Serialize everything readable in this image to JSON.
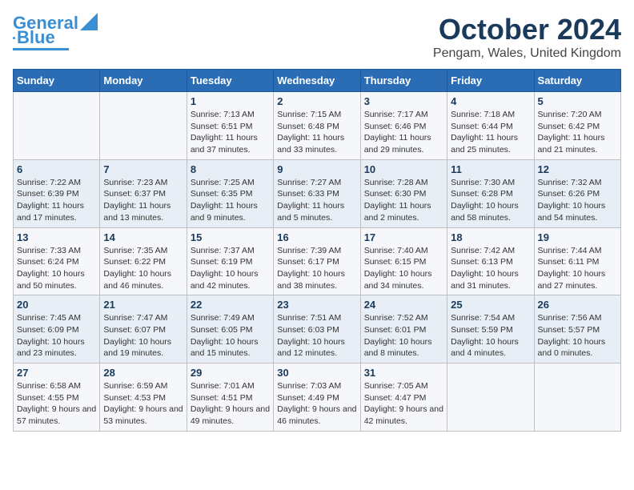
{
  "logo": {
    "line1": "General",
    "line2": "Blue"
  },
  "title": "October 2024",
  "subtitle": "Pengam, Wales, United Kingdom",
  "headers": [
    "Sunday",
    "Monday",
    "Tuesday",
    "Wednesday",
    "Thursday",
    "Friday",
    "Saturday"
  ],
  "rows": [
    [
      {
        "num": "",
        "info": ""
      },
      {
        "num": "",
        "info": ""
      },
      {
        "num": "1",
        "info": "Sunrise: 7:13 AM\nSunset: 6:51 PM\nDaylight: 11 hours and 37 minutes."
      },
      {
        "num": "2",
        "info": "Sunrise: 7:15 AM\nSunset: 6:48 PM\nDaylight: 11 hours and 33 minutes."
      },
      {
        "num": "3",
        "info": "Sunrise: 7:17 AM\nSunset: 6:46 PM\nDaylight: 11 hours and 29 minutes."
      },
      {
        "num": "4",
        "info": "Sunrise: 7:18 AM\nSunset: 6:44 PM\nDaylight: 11 hours and 25 minutes."
      },
      {
        "num": "5",
        "info": "Sunrise: 7:20 AM\nSunset: 6:42 PM\nDaylight: 11 hours and 21 minutes."
      }
    ],
    [
      {
        "num": "6",
        "info": "Sunrise: 7:22 AM\nSunset: 6:39 PM\nDaylight: 11 hours and 17 minutes."
      },
      {
        "num": "7",
        "info": "Sunrise: 7:23 AM\nSunset: 6:37 PM\nDaylight: 11 hours and 13 minutes."
      },
      {
        "num": "8",
        "info": "Sunrise: 7:25 AM\nSunset: 6:35 PM\nDaylight: 11 hours and 9 minutes."
      },
      {
        "num": "9",
        "info": "Sunrise: 7:27 AM\nSunset: 6:33 PM\nDaylight: 11 hours and 5 minutes."
      },
      {
        "num": "10",
        "info": "Sunrise: 7:28 AM\nSunset: 6:30 PM\nDaylight: 11 hours and 2 minutes."
      },
      {
        "num": "11",
        "info": "Sunrise: 7:30 AM\nSunset: 6:28 PM\nDaylight: 10 hours and 58 minutes."
      },
      {
        "num": "12",
        "info": "Sunrise: 7:32 AM\nSunset: 6:26 PM\nDaylight: 10 hours and 54 minutes."
      }
    ],
    [
      {
        "num": "13",
        "info": "Sunrise: 7:33 AM\nSunset: 6:24 PM\nDaylight: 10 hours and 50 minutes."
      },
      {
        "num": "14",
        "info": "Sunrise: 7:35 AM\nSunset: 6:22 PM\nDaylight: 10 hours and 46 minutes."
      },
      {
        "num": "15",
        "info": "Sunrise: 7:37 AM\nSunset: 6:19 PM\nDaylight: 10 hours and 42 minutes."
      },
      {
        "num": "16",
        "info": "Sunrise: 7:39 AM\nSunset: 6:17 PM\nDaylight: 10 hours and 38 minutes."
      },
      {
        "num": "17",
        "info": "Sunrise: 7:40 AM\nSunset: 6:15 PM\nDaylight: 10 hours and 34 minutes."
      },
      {
        "num": "18",
        "info": "Sunrise: 7:42 AM\nSunset: 6:13 PM\nDaylight: 10 hours and 31 minutes."
      },
      {
        "num": "19",
        "info": "Sunrise: 7:44 AM\nSunset: 6:11 PM\nDaylight: 10 hours and 27 minutes."
      }
    ],
    [
      {
        "num": "20",
        "info": "Sunrise: 7:45 AM\nSunset: 6:09 PM\nDaylight: 10 hours and 23 minutes."
      },
      {
        "num": "21",
        "info": "Sunrise: 7:47 AM\nSunset: 6:07 PM\nDaylight: 10 hours and 19 minutes."
      },
      {
        "num": "22",
        "info": "Sunrise: 7:49 AM\nSunset: 6:05 PM\nDaylight: 10 hours and 15 minutes."
      },
      {
        "num": "23",
        "info": "Sunrise: 7:51 AM\nSunset: 6:03 PM\nDaylight: 10 hours and 12 minutes."
      },
      {
        "num": "24",
        "info": "Sunrise: 7:52 AM\nSunset: 6:01 PM\nDaylight: 10 hours and 8 minutes."
      },
      {
        "num": "25",
        "info": "Sunrise: 7:54 AM\nSunset: 5:59 PM\nDaylight: 10 hours and 4 minutes."
      },
      {
        "num": "26",
        "info": "Sunrise: 7:56 AM\nSunset: 5:57 PM\nDaylight: 10 hours and 0 minutes."
      }
    ],
    [
      {
        "num": "27",
        "info": "Sunrise: 6:58 AM\nSunset: 4:55 PM\nDaylight: 9 hours and 57 minutes."
      },
      {
        "num": "28",
        "info": "Sunrise: 6:59 AM\nSunset: 4:53 PM\nDaylight: 9 hours and 53 minutes."
      },
      {
        "num": "29",
        "info": "Sunrise: 7:01 AM\nSunset: 4:51 PM\nDaylight: 9 hours and 49 minutes."
      },
      {
        "num": "30",
        "info": "Sunrise: 7:03 AM\nSunset: 4:49 PM\nDaylight: 9 hours and 46 minutes."
      },
      {
        "num": "31",
        "info": "Sunrise: 7:05 AM\nSunset: 4:47 PM\nDaylight: 9 hours and 42 minutes."
      },
      {
        "num": "",
        "info": ""
      },
      {
        "num": "",
        "info": ""
      }
    ]
  ]
}
